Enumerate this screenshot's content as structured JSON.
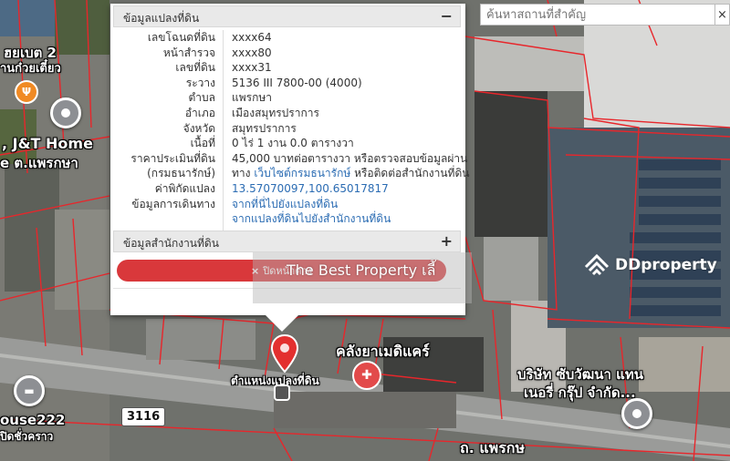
{
  "panel": {
    "section_title": "ข้อมูลแปลงที่ดิน",
    "section_toggle": "−",
    "rows": [
      {
        "label": "เลขโฉนดที่ดิน",
        "value": "xxxx64"
      },
      {
        "label": "หน้าสำรวจ",
        "value": "xxxx80"
      },
      {
        "label": "เลขที่ดิน",
        "value": "xxxx31"
      },
      {
        "label": "ระวาง",
        "value": "5136 III 7800-00 (4000)"
      },
      {
        "label": "ตำบล",
        "value": "แพรกษา"
      },
      {
        "label": "อำเภอ",
        "value": "เมืองสมุทรปราการ"
      },
      {
        "label": "จังหวัด",
        "value": "สมุทรปราการ"
      },
      {
        "label": "เนื้อที่",
        "value": "0 ไร่ 1 งาน 0.0 ตารางวา"
      },
      {
        "label": "ราคาประเมินที่ดิน",
        "value": "45,000 บาทต่อตารางวา หรือตรวจสอบข้อมูลผ่าน"
      },
      {
        "label": "(กรมธนารักษ์)",
        "value_pre": "ทาง ",
        "value_link": "เว็บไซต์กรมธนารักษ์",
        "value_post": " หรือติดต่อสำนักงานที่ดิน"
      },
      {
        "label": "ค่าพิกัดแปลง",
        "value_link": "13.57070097,100.65017817"
      },
      {
        "label": "ข้อมูลการเดินทาง",
        "value_link": "จากที่นี่ไปยังแปลงที่ดิน"
      },
      {
        "label": "",
        "value_link": "จากแปลงที่ดินไปยังสำนักงานที่ดิน"
      }
    ],
    "office_section_title": "ข้อมูลสำนักงานที่ดิน",
    "office_toggle": "+",
    "close_x": "×",
    "close_label": "ปิดหน้าต่าง"
  },
  "search": {
    "placeholder": "ค้นหาสถานที่สำคัญ",
    "close": "×"
  },
  "banner_text": "The Best Property  เลี้",
  "watermark": "DDproperty",
  "map_labels": {
    "top_left": "ฮยเบต 2",
    "top_left2": "านก๋วยเตี๋ยว",
    "jt_home": ", J&T Home",
    "jt_home2": "e ต.แพรกษา",
    "pharmacy": "คลังยาเมดิแคร์",
    "company": "บริษัท ซับวัฒนา แทน",
    "company2": "เนอรี่ กรุ๊ป จำกัด...",
    "plot_location": "ตำแหน่งแปลงที่ดิน",
    "route": "3116",
    "house": "ouse222",
    "house2": "ปิดชั่วคราว",
    "road": "ถ. แพรกษ"
  },
  "colors": {
    "parcel_line": "#e8262b",
    "close_bar": "#d9383b",
    "link": "#2b6cb3",
    "pin_red": "#e3302f"
  }
}
